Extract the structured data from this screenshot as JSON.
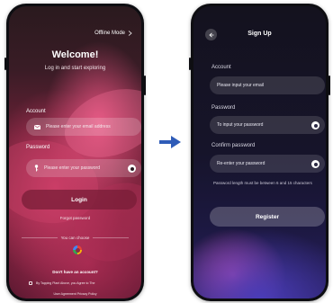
{
  "login_screen": {
    "offline_mode": "Offline Mode",
    "title": "Welcome!",
    "subtitle": "Log in and start exploring",
    "account_label": "Account",
    "email_placeholder": "Please enter your email address",
    "password_label": "Password",
    "password_placeholder": "Please enter your password",
    "login_button": "Login",
    "forgot_password": "Forgot password",
    "or_choose": "You can choose",
    "no_account": "Don't have an account?",
    "terms_line": "By Tapping Plant Above, you Agree to The",
    "terms_links": "User Agreement    Privacy Policy"
  },
  "signup_screen": {
    "title": "Sign Up",
    "account_label": "Account",
    "email_placeholder": "Please input your email",
    "password_label": "Password",
    "password_placeholder": "To input your password",
    "confirm_label": "Confirm password",
    "confirm_placeholder": "Re-enter your password",
    "hint": "Password length must be between 6 and 15 characters",
    "register_button": "Register"
  },
  "icons": {
    "offline_chevron": "chevron-right-icon",
    "email": "mail-icon",
    "password": "key-icon",
    "eye": "eye-icon",
    "google": "google-icon",
    "back": "back-arrow-icon",
    "flow_arrow": "arrow-right-icon"
  },
  "colors": {
    "login_accent": "#c73a64",
    "signup_accent": "#4a3cb8",
    "arrow": "#2f5cb8"
  }
}
